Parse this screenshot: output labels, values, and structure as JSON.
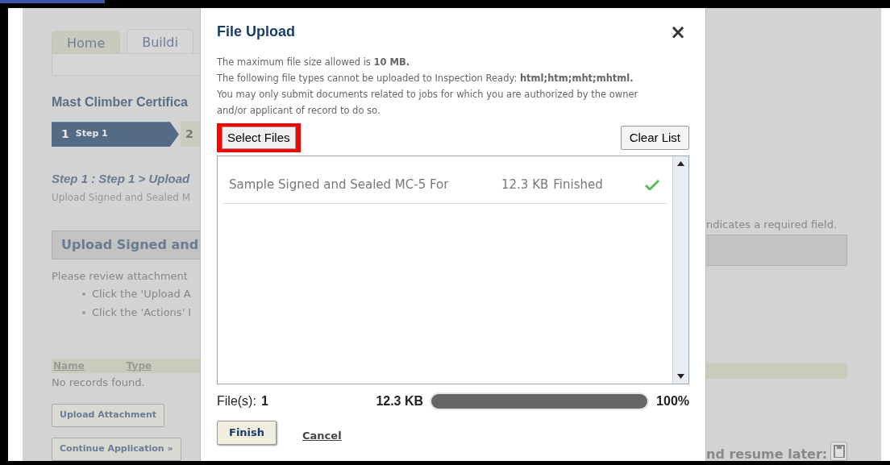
{
  "page": {
    "tabs": [
      {
        "label": "Home",
        "selected": false
      },
      {
        "label": "Buildi",
        "selected": true
      }
    ],
    "title": "Mast Climber Certifica",
    "steps": [
      {
        "number": "1",
        "label": "Step 1",
        "selected": true
      },
      {
        "number": "2",
        "selected": false
      }
    ],
    "step_heading": "Step 1 : Step 1 > Upload",
    "step_subtext": "Upload Signed and Sealed M",
    "section_header": "Upload Signed and",
    "intro": "Please review attachment",
    "bullets": [
      "Click the 'Upload A",
      "Click the 'Actions' I"
    ],
    "table": {
      "columns": [
        "Name",
        "Type"
      ],
      "empty_text": "No records found."
    },
    "buttons": [
      "Upload Attachment",
      "Continue Application »"
    ],
    "required_note": "ndicates a required field.",
    "save_label": "nd resume later:"
  },
  "dialog": {
    "title": "File Upload",
    "close": "×",
    "notes": [
      "The maximum file size allowed is **10 MB.**",
      "The following file types cannot be uploaded to Inspection Ready: **html;htm;mht;mhtml.**",
      "You may only submit documents related to jobs for which you are authorized by the owner and/or applicant of record to do so."
    ],
    "select_button": {
      "label": "Select Files",
      "highlighted": true
    },
    "clear_button": "Clear List",
    "files": [
      {
        "name": "Sample Signed and Sealed MC-5 For",
        "size": "12.3 KB",
        "status": "Finished",
        "done": true
      }
    ],
    "files_label": "File(s):",
    "files_count": "1",
    "total_size": "12.3 KB",
    "progress": {
      "level": 1,
      "reading": "100%"
    },
    "finish_button": "Finish",
    "cancel_link": "Cancel"
  }
}
